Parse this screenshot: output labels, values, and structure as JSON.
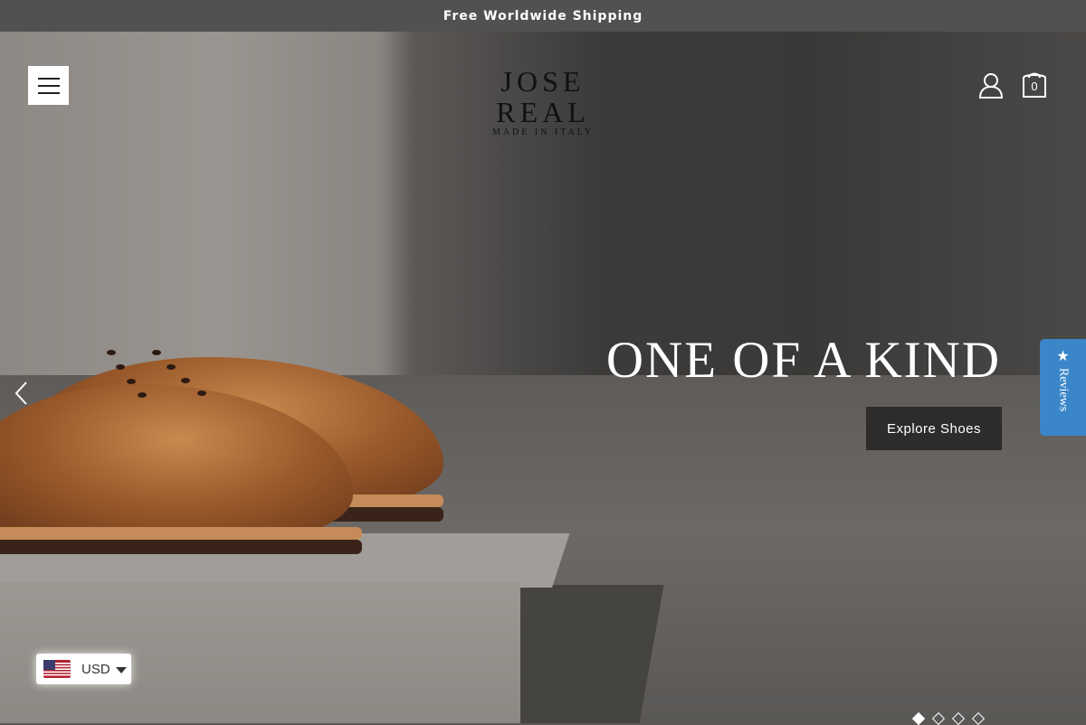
{
  "announcement": {
    "text": "Free Worldwide Shipping"
  },
  "header": {
    "logo": {
      "wordmark": "JOSE REAL",
      "tagline": "MADE IN ITALY"
    },
    "cart": {
      "count": "0"
    },
    "icons": {
      "menu": "hamburger-menu-icon",
      "account": "user-icon",
      "cart": "shopping-bag-icon"
    }
  },
  "hero": {
    "headline": "ONE OF A KIND",
    "cta_label": "Explore Shoes",
    "slides": {
      "total": 4,
      "active": 1
    }
  },
  "reviews_tab": {
    "label": "Reviews",
    "icon": "star-icon",
    "color": "#3a86c9"
  },
  "currency": {
    "code": "USD",
    "flag": "us-flag-icon"
  }
}
